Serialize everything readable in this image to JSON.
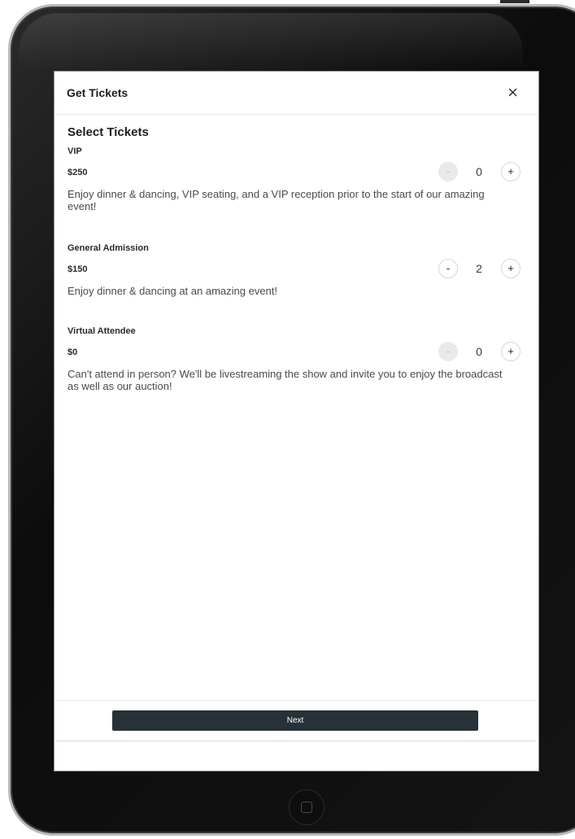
{
  "modal": {
    "title": "Get Tickets",
    "close_icon": "close-icon"
  },
  "section_title": "Select Tickets",
  "tickets": [
    {
      "name": "VIP",
      "price": "$250",
      "quantity": "0",
      "minus_label": "-",
      "plus_label": "+",
      "minus_disabled": true,
      "description": "Enjoy dinner & dancing, VIP seating, and a VIP reception prior to the start of our amazing event!"
    },
    {
      "name": "General Admission",
      "price": "$150",
      "quantity": "2",
      "minus_label": "-",
      "plus_label": "+",
      "minus_disabled": false,
      "description": "Enjoy dinner & dancing at an amazing event!"
    },
    {
      "name": "Virtual Attendee",
      "price": "$0",
      "quantity": "0",
      "minus_label": "-",
      "plus_label": "+",
      "minus_disabled": true,
      "description": "Can't attend in person? We'll be livestreaming the show and invite you to enjoy the broadcast as well as our auction!"
    }
  ],
  "footer": {
    "next_label": "Next",
    "button_color": "#263238"
  }
}
